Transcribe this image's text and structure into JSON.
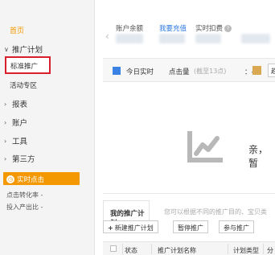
{
  "sidebar": {
    "home": "首页",
    "promo_plan": "推广计划",
    "standard_promo": "标准推广",
    "activity_zone": "活动专区",
    "reports": "报表",
    "account": "账户",
    "tools": "工具",
    "third_party": "第三方",
    "realtime_click": "实时点击",
    "click_conversion": "点击转化率 -",
    "roi": "投入产出比 -"
  },
  "top": {
    "balance_label": "账户余额",
    "recharge": "我要充值",
    "realtime_deduct": "实时扣费"
  },
  "today": {
    "title": "今日实时",
    "clicks_label": "点击量",
    "clicks_hint": "(截至13点)",
    "clicks_value": "：-",
    "btn": "趋"
  },
  "empty_msg": "亲，暂",
  "plan": {
    "tab": "我的推广计划",
    "hint": "您可以根据不同的推广目的、宝贝类",
    "btn_new": "新建推广计划",
    "btn_new_plus": "+",
    "btn_pause": "暂停推广",
    "btn_join": "参与推广"
  },
  "table": {
    "col_status": "状态",
    "col_name": "推广计划名称",
    "col_type": "计划类型",
    "col_more": "分"
  }
}
